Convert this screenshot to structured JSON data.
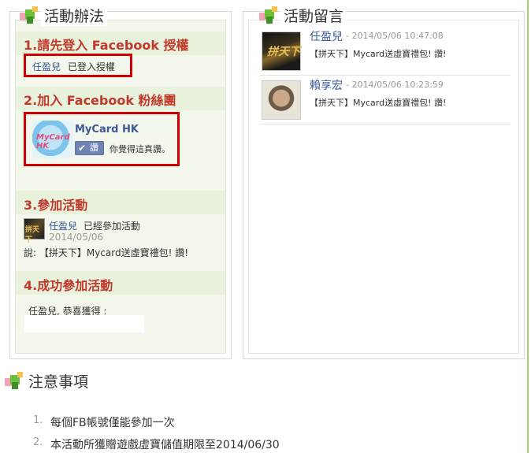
{
  "activity_rules": {
    "title": "活動辦法",
    "step1": {
      "title": "1.請先登入 Facebook 授權",
      "user_name": "任盈兒",
      "login_status": "已登入授權"
    },
    "step2": {
      "title": "2.加入 Facebook 粉絲團",
      "page_name": "MyCard HK",
      "avatar_text": "MyCard HK",
      "like_button": "讚",
      "like_text": "你覺得這真讚。"
    },
    "step3": {
      "title": "3.參加活動",
      "avatar_text": "拼天下",
      "user_name": "任盈兒",
      "status": "已經參加活動",
      "date": "2014/05/06",
      "said": "說: 【拼天下】Mycard送虛寶禮包! 讚!"
    },
    "step4": {
      "title": "4.成功參加活動",
      "congrats": "任盈兒, 恭喜獲得 :"
    }
  },
  "comments": {
    "title": "活動留言",
    "items": [
      {
        "name": "任盈兒",
        "time": "- 2014/05/06 10:47:08",
        "text": "【拼天下】Mycard送虛寶禮包! 讚!",
        "avatar_text": "拼天下"
      },
      {
        "name": "賴享宏",
        "time": "- 2014/05/06 10:23:59",
        "text": "【拼天下】Mycard送虛寶禮包! 讚!"
      }
    ]
  },
  "notes": {
    "title": "注意事項",
    "items": [
      {
        "num": "1.",
        "text": "每個FB帳號僅能參加一次"
      },
      {
        "num": "2.",
        "text": "本活動所獲贈遊戲虛寶儲值期限至2014/06/30"
      }
    ]
  },
  "colors": {
    "step_title": "#c0392b",
    "link_blue": "#3b5998",
    "highlight_border": "#d00000",
    "panel_bg": "#f3f7ec",
    "accent_green": "#a6d468"
  }
}
